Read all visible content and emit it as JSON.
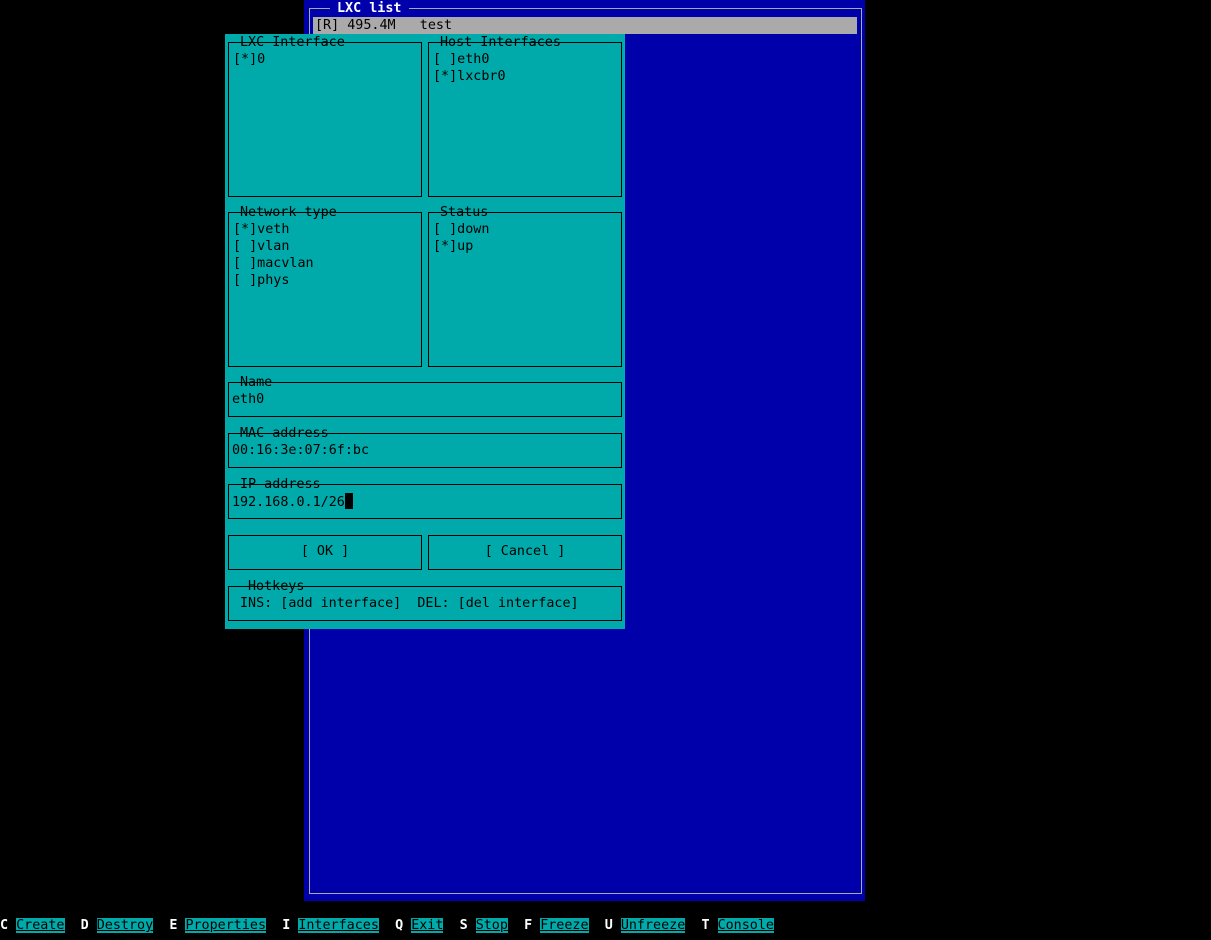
{
  "lxc_list": {
    "title": "LXC list",
    "rows": [
      {
        "text": "[R] 495.4M   test"
      }
    ]
  },
  "dialog": {
    "lxc_interface": {
      "label": "LXC Interface",
      "items": [
        "[*]0"
      ]
    },
    "host_interfaces": {
      "label": "Host Interfaces",
      "items": [
        "[ ]eth0",
        "[*]lxcbr0"
      ]
    },
    "network_type": {
      "label": "Network type",
      "items": [
        "[*]veth",
        "[ ]vlan",
        "[ ]macvlan",
        "[ ]phys"
      ]
    },
    "status": {
      "label": "Status",
      "items": [
        "[ ]down",
        "[*]up"
      ]
    },
    "name": {
      "label": "Name",
      "value": "eth0"
    },
    "mac": {
      "label": "MAC address",
      "value": "00:16:3e:07:6f:bc"
    },
    "ip": {
      "label": "IP address",
      "value": "192.168.0.1/26"
    },
    "ok_label": "[ OK ]",
    "cancel_label": "[ Cancel ]",
    "hotkeys": {
      "label": "Hotkeys",
      "text": "INS: [add interface]  DEL: [del interface]"
    }
  },
  "menu": [
    {
      "key": "C",
      "label": "Create"
    },
    {
      "key": "D",
      "label": "Destroy"
    },
    {
      "key": "E",
      "label": "Properties"
    },
    {
      "key": "I",
      "label": "Interfaces"
    },
    {
      "key": "Q",
      "label": "Exit"
    },
    {
      "key": "S",
      "label": "Stop"
    },
    {
      "key": "F",
      "label": "Freeze"
    },
    {
      "key": "U",
      "label": "Unfreeze"
    },
    {
      "key": "T",
      "label": "Console"
    }
  ],
  "colors": {
    "window_bg": "#0000aa",
    "dialog_bg": "#00aaaa",
    "highlight": "#aaaaaa"
  }
}
